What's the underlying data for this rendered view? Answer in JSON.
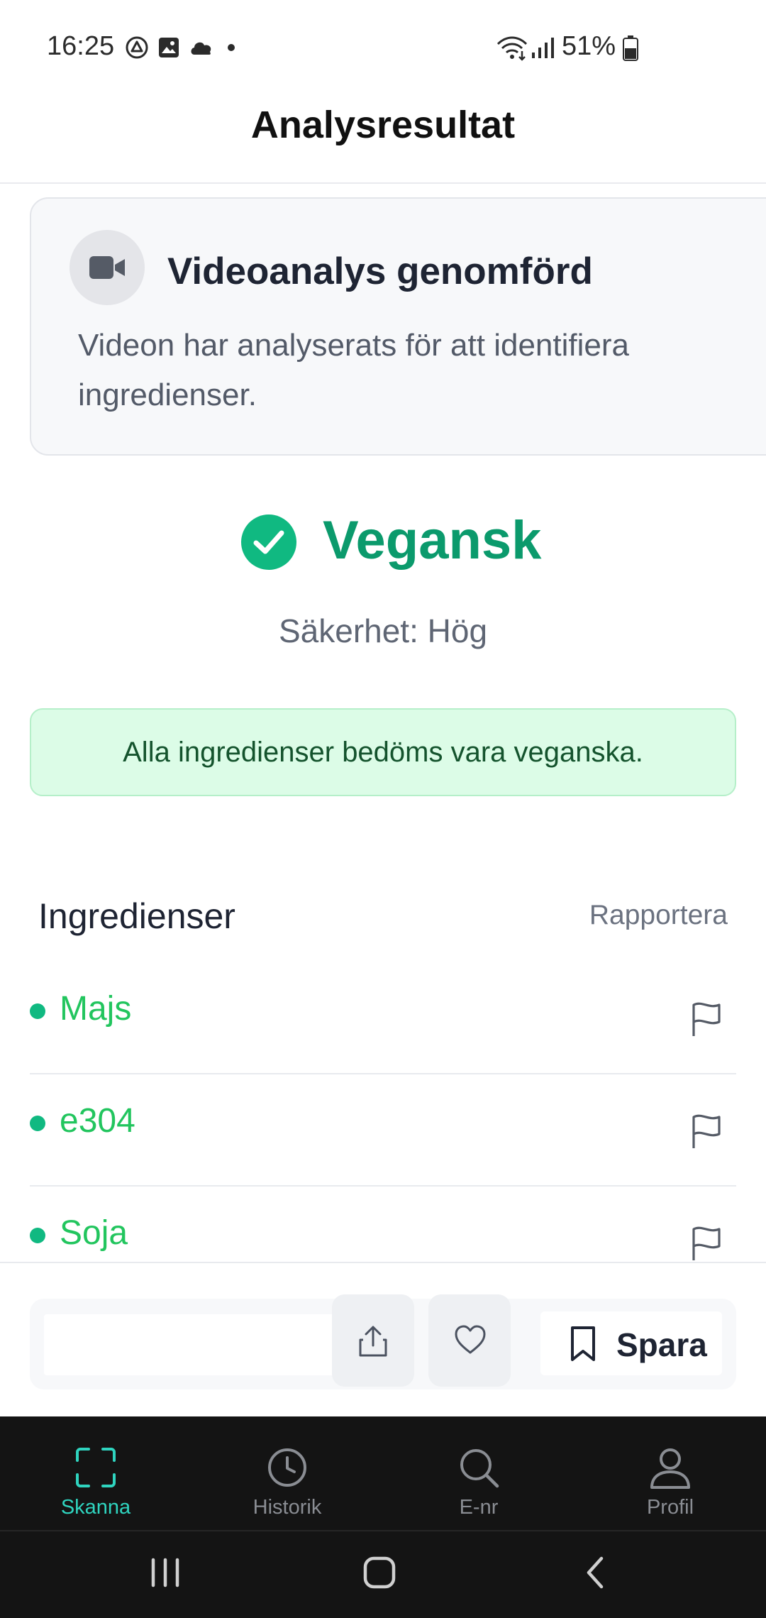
{
  "status_bar": {
    "time": "16:25",
    "battery": "51%",
    "icons_left": [
      "drive-icon",
      "gallery-icon",
      "cloud-icon",
      "dot-icon"
    ],
    "icons_right": [
      "wifi-icon",
      "signal-icon",
      "battery-icon"
    ]
  },
  "header": {
    "title": "Analysresultat"
  },
  "video_card": {
    "icon": "video-camera-icon",
    "title": "Videoanalys genomförd",
    "description": "Videon har analyserats för att identifiera ingredienser."
  },
  "result": {
    "label": "Vegansk",
    "confidence": "Säkerhet: Hög",
    "verdict": "Alla ingredienser bedöms vara veganska.",
    "colors": {
      "accent": "#0b9a6c",
      "check": "#10b981",
      "verdict_bg": "#dcfce7"
    }
  },
  "ingredients": {
    "heading": "Ingredienser",
    "report_label": "Rapportera",
    "items": [
      {
        "name": "Majs"
      },
      {
        "name": "e304"
      },
      {
        "name": "Soja"
      }
    ],
    "item_color": "#22c55e"
  },
  "actions": {
    "save_label": "Spara",
    "icons": [
      "share-icon",
      "heart-icon",
      "bookmark-icon"
    ]
  },
  "bottom_nav": {
    "items": [
      {
        "label": "Skanna",
        "icon": "scan-icon",
        "active": true
      },
      {
        "label": "Historik",
        "icon": "clock-icon",
        "active": false
      },
      {
        "label": "E-nr",
        "icon": "search-icon",
        "active": false
      },
      {
        "label": "Profil",
        "icon": "user-icon",
        "active": false
      }
    ],
    "active_color": "#2fd4bf"
  },
  "system_nav": {
    "buttons": [
      "recents-icon",
      "home-icon",
      "back-icon"
    ]
  }
}
